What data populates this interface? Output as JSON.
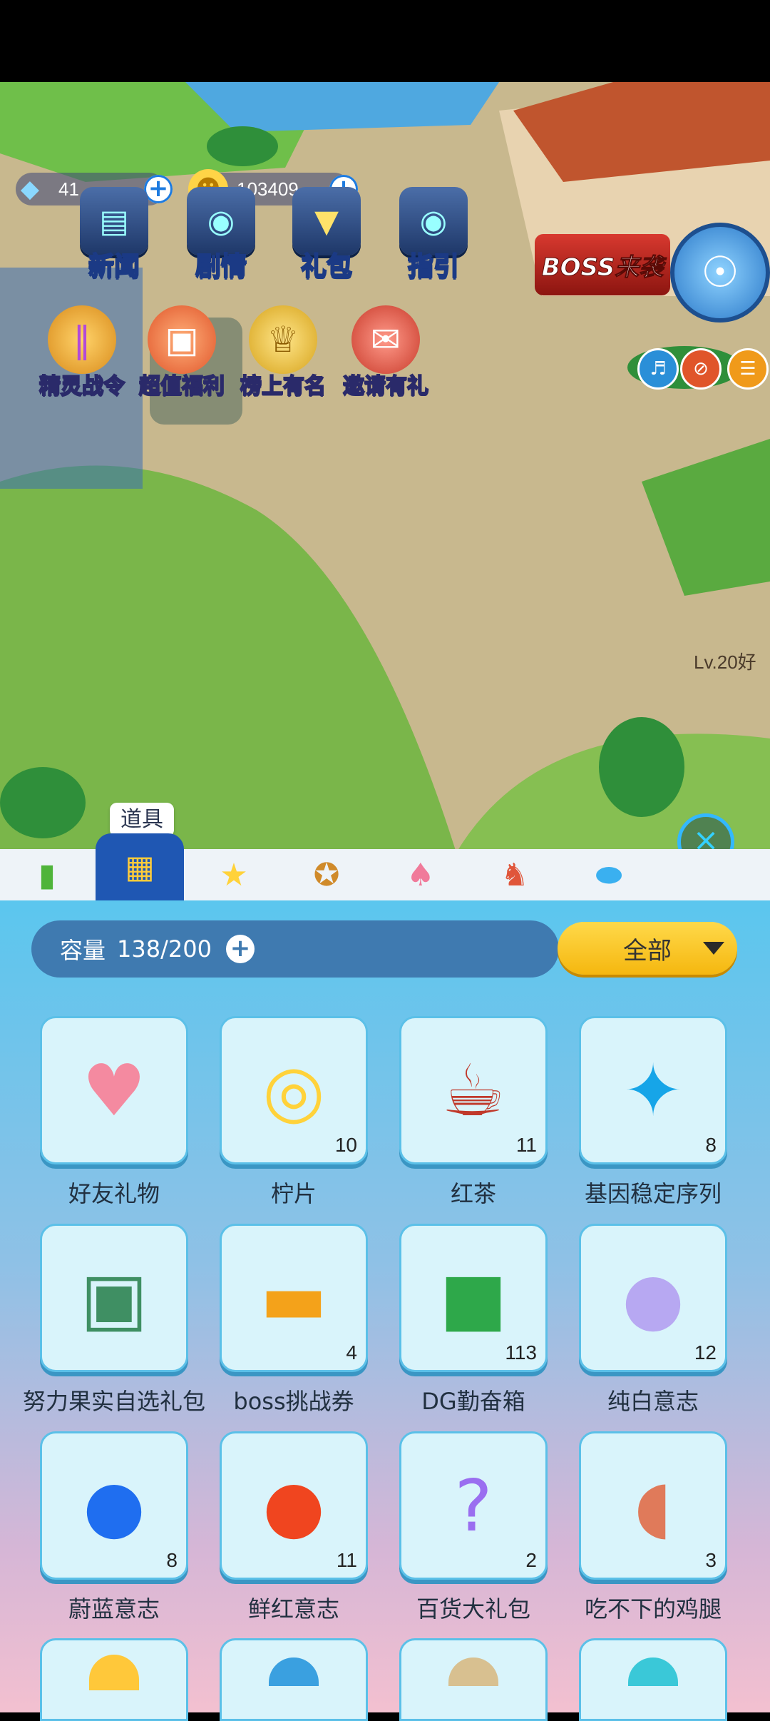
{
  "resources": {
    "gems": "41",
    "coins": "103409"
  },
  "top_menu": [
    "新闻",
    "剧情",
    "礼包",
    "指引"
  ],
  "activities": [
    "精灵战令",
    "超值福利",
    "榜上有名",
    "邀请有礼"
  ],
  "boss_banner": "BOSS来袭",
  "player_tag": "Lv.20好",
  "tooltip": "道具",
  "bag": {
    "capacity_label": "容量",
    "capacity_value": "138/200",
    "filter": "全部"
  },
  "items": [
    {
      "name": "好友礼物",
      "count": "",
      "icon": "gift-bag-icon",
      "color": "#f48aa0"
    },
    {
      "name": "柠片",
      "count": "10",
      "icon": "lemon-slices-icon",
      "color": "#ffd23a"
    },
    {
      "name": "红茶",
      "count": "11",
      "icon": "tea-cup-icon",
      "color": "#c0392b"
    },
    {
      "name": "基因稳定序列",
      "count": "8",
      "icon": "molecule-icon",
      "color": "#16a5e8"
    },
    {
      "name": "努力果实自选礼包",
      "count": "",
      "icon": "gift-box-icon",
      "color": "#3f8f63"
    },
    {
      "name": "boss挑战券",
      "count": "4",
      "icon": "ticket-icon",
      "color": "#f4a21a"
    },
    {
      "name": "DG勤奋箱",
      "count": "113",
      "icon": "chest-icon",
      "color": "#2ea84a"
    },
    {
      "name": "纯白意志",
      "count": "12",
      "icon": "white-orb-icon",
      "color": "#b7a8f2"
    },
    {
      "name": "蔚蓝意志",
      "count": "8",
      "icon": "blue-orb-icon",
      "color": "#1f6ef0"
    },
    {
      "name": "鲜红意志",
      "count": "11",
      "icon": "red-orb-icon",
      "color": "#f0451f"
    },
    {
      "name": "百货大礼包",
      "count": "2",
      "icon": "mystery-box-icon",
      "color": "#9a6ef0"
    },
    {
      "name": "吃不下的鸡腿",
      "count": "3",
      "icon": "drumstick-icon",
      "color": "#e07a5a"
    }
  ]
}
